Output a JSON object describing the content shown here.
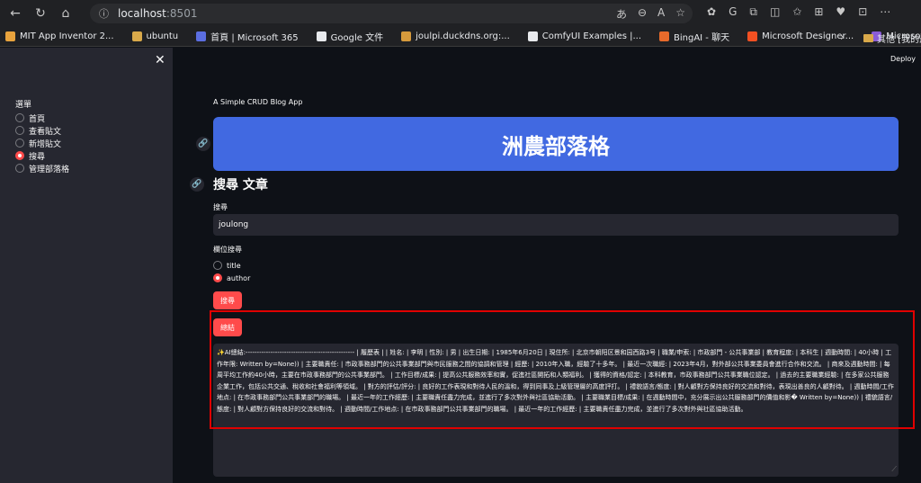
{
  "browser": {
    "url_host": "localhost",
    "url_port": ":8501",
    "bookmarks": [
      {
        "label": "MIT App Inventor 2...",
        "color": "#e8a33d"
      },
      {
        "label": "ubuntu",
        "color": "#d9a94a"
      },
      {
        "label": "首頁 | Microsoft 365",
        "color": "#5b6ee1"
      },
      {
        "label": "Google 文件",
        "color": "#e8eaed"
      },
      {
        "label": "joulpi.duckdns.org:...",
        "color": "#d69a3c"
      },
      {
        "label": "ComfyUI Examples |...",
        "color": "#e8eaed"
      },
      {
        "label": "BingAI - 聊天",
        "color": "#e86a2b"
      },
      {
        "label": "Microsoft Designer...",
        "color": "#f25022"
      },
      {
        "label": "Microsoft Designer...",
        "color": "#8a5cd6"
      }
    ],
    "bookmarks_other": "其他 [我的最"
  },
  "sidebar": {
    "menu_title": "選單",
    "items": [
      {
        "label": "首頁",
        "selected": false
      },
      {
        "label": "查看貼文",
        "selected": false
      },
      {
        "label": "新增貼文",
        "selected": false
      },
      {
        "label": "搜尋",
        "selected": true
      },
      {
        "label": "管理部落格",
        "selected": false
      }
    ]
  },
  "main": {
    "deploy_label": "Deploy",
    "app_name": "A Simple CRUD Blog App",
    "banner_title": "洲農部落格",
    "section_title": "搜尋 文章",
    "search_label": "搜尋",
    "search_value": "joulong",
    "field_label": "欄位搜尋",
    "field_options": [
      {
        "label": "title",
        "selected": false
      },
      {
        "label": "author",
        "selected": true
      }
    ],
    "search_button": "搜尋",
    "summary_button": "總結",
    "summary_text": "✨AI總結:------------------------------------------------ | 履歷表 | | 姓名: | 李明 | 性別: | 男 | 出生日期: | 1985年6月20日 | 現住所: | 北京市朝阳区景和园西路3号 | 職業/申索: | 市政部門 - 公共事業部 | 教育程度: | 本科生 | 週動時間: | 40小時 | 工作年限: Written by=None)) | 主要職責任: | 市政事務部門的公共事業部門與市民服務之間的協調和管理 | 經歷: | 2010年入職，經驗了十多年。 | 最近一次職經: | 2023年4月，對外部公共事業委員會進行合作和交流。 | 商來及週動時間: | 每周平均工作約40小時，主要在市政事務部門的公共事業部門。 | 工作目標/成果: | 提高公共服務效率和實，促進社區開拓和人類福利。 | 獲得的資格/認定: | 本科教育，市政事務部門公共事業職位認定。 | 過去的主要職業經驗: | 在多家公共服務企業工作，包括公共交通、稅收和社會福利等領域。 | 對方的評估/評分: | 良好的工作表現和對待人民的溫和，得到同事及上級管理層的高度評打。 | 禮貌語言/態度: | 對人顧對方保持良好的交流和對待，表現出善良的人顧對待。 | 週動時間/工作地点: | 在市政事務部門公共事業部門的職場。 | 最近一年的工作經歷: | 主要職責任盡力完成，並進行了多次對外與社區協助活動。 | 主要職業目標/成果: | 在週動時間中，充分展示出公共服務部門的價值和影� Written by=None)) | 禮貌語言/態度: | 對人顧對方保持良好的交流和對待。 | 週動時間/工作地点: | 在市政事務部門公共事業部門的職場。 | 最近一年的工作經歷: | 主要職責任盡力完成，並進行了多次對外與社區協助活動。"
  },
  "colors": {
    "accent": "#ff4b4b",
    "banner": "#4169e1",
    "highlight": "#e00000"
  }
}
